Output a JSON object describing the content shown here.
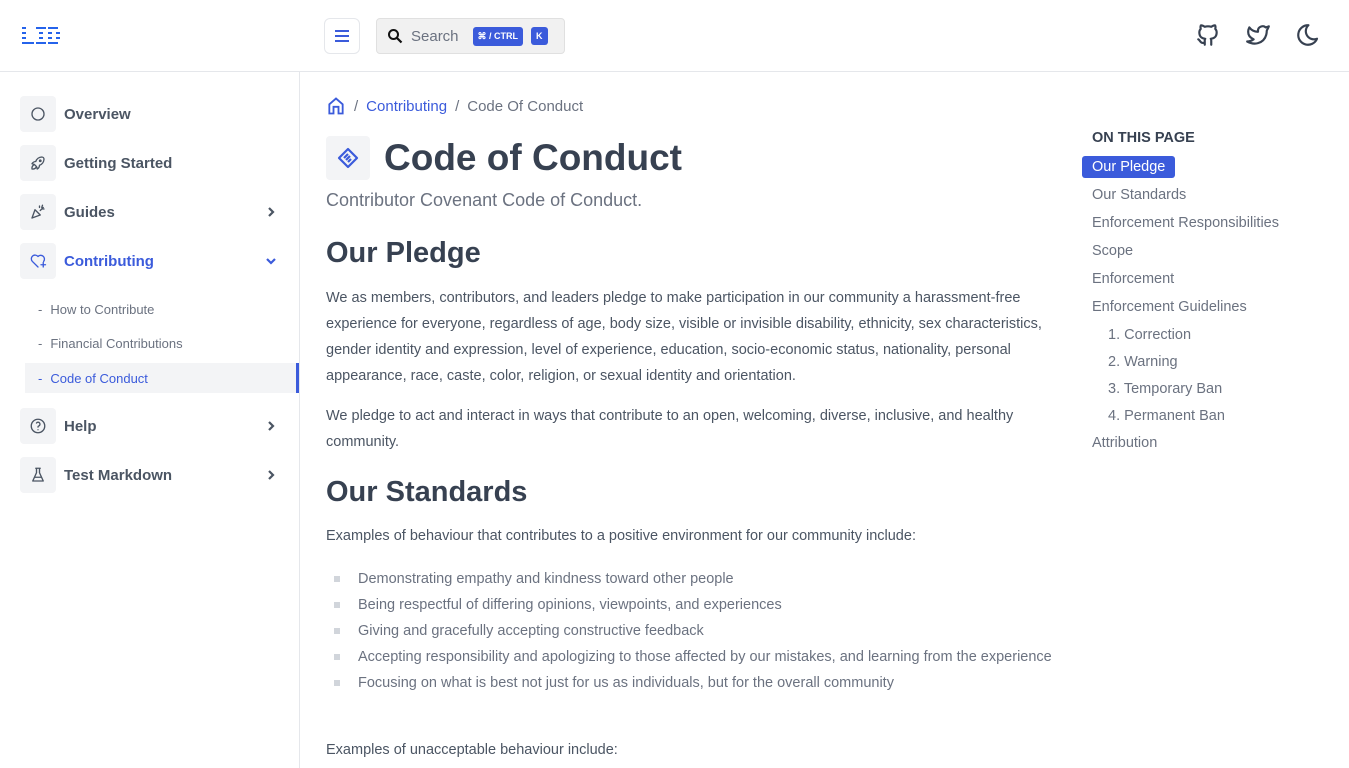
{
  "header": {
    "logo": "LD",
    "search_placeholder": "Search",
    "shortcut_mod": "⌘ / CTRL",
    "shortcut_key": "K",
    "icons": [
      "github-icon",
      "twitter-icon",
      "moon-icon"
    ]
  },
  "sidebar": {
    "items": [
      {
        "label": "Overview",
        "icon": "circle-icon"
      },
      {
        "label": "Getting Started",
        "icon": "rocket-icon"
      },
      {
        "label": "Guides",
        "icon": "confetti-icon"
      },
      {
        "label": "Contributing",
        "icon": "heart-plus-icon"
      },
      {
        "label": "Help",
        "icon": "help-circle-icon"
      },
      {
        "label": "Test Markdown",
        "icon": "flask-icon"
      }
    ],
    "subitems": [
      "How to Contribute",
      "Financial Contributions",
      "Code of Conduct"
    ]
  },
  "breadcrumb": {
    "parent": "Contributing",
    "current": "Code Of Conduct"
  },
  "page": {
    "title": "Code of Conduct",
    "subtitle": "Contributor Covenant Code of Conduct.",
    "h_pledge": "Our Pledge",
    "pledge_p1": "We as members, contributors, and leaders pledge to make participation in our community a harassment-free experience for everyone, regardless of age, body size, visible or invisible disability, ethnicity, sex characteristics, gender identity and expression, level of experience, education, socio-economic status, nationality, personal appearance, race, caste, color, religion, or sexual identity and orientation.",
    "pledge_p2": "We pledge to act and interact in ways that contribute to an open, welcoming, diverse, inclusive, and healthy community.",
    "h_standards": "Our Standards",
    "standards_intro": "Examples of behaviour that contributes to a positive environment for our community include:",
    "standards_list": [
      "Demonstrating empathy and kindness toward other people",
      "Being respectful of differing opinions, viewpoints, and experiences",
      "Giving and gracefully accepting constructive feedback",
      "Accepting responsibility and apologizing to those affected by our mistakes, and learning from the experience",
      "Focusing on what is best not just for us as individuals, but for the overall community"
    ],
    "unacceptable_intro": "Examples of unacceptable behaviour include:"
  },
  "toc": {
    "title": "ON THIS PAGE",
    "items": [
      "Our Pledge",
      "Our Standards",
      "Enforcement Responsibilities",
      "Scope",
      "Enforcement",
      "Enforcement Guidelines",
      "1. Correction",
      "2. Warning",
      "3. Temporary Ban",
      "4. Permanent Ban",
      "Attribution"
    ]
  },
  "colors": {
    "accent": "#3b5bdb",
    "text": "#4b5563"
  }
}
